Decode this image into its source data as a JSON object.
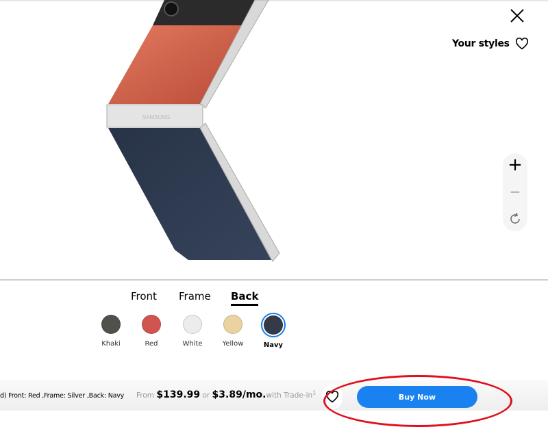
{
  "header": {
    "close_icon": "close-icon",
    "your_styles_label": "Your styles",
    "heart_icon": "heart-outline-icon"
  },
  "zoom_controls": {
    "zoom_in": "+",
    "zoom_out": "−",
    "rotate_icon": "rotate-icon"
  },
  "product_image": {
    "brand_text": "SAMSUNG",
    "front_color": "#d2614a",
    "frame_color": "#d9d9d9",
    "back_color": "#2e3a4d"
  },
  "tabs": [
    {
      "label": "Front"
    },
    {
      "label": "Frame"
    },
    {
      "label": "Back",
      "active": true
    }
  ],
  "swatches": [
    {
      "label": "Khaki",
      "color": "#4e524b"
    },
    {
      "label": "Red",
      "color": "#d05550"
    },
    {
      "label": "White",
      "color": "#ececec"
    },
    {
      "label": "Yellow",
      "color": "#ead3a0"
    },
    {
      "label": "Navy",
      "color": "#343a48",
      "selected": true
    }
  ],
  "bottom_bar": {
    "summary": "d) Front: Red ,Frame: Silver ,Back: Navy",
    "from": "From ",
    "price": "$139.99",
    "or": " or ",
    "monthly": "$3.89/mo.",
    "trade_in": "with Trade-in",
    "footnote": "1",
    "buy_now": "Buy Now"
  },
  "colors": {
    "accent": "#1a82f0",
    "annotation": "#e0101a"
  }
}
